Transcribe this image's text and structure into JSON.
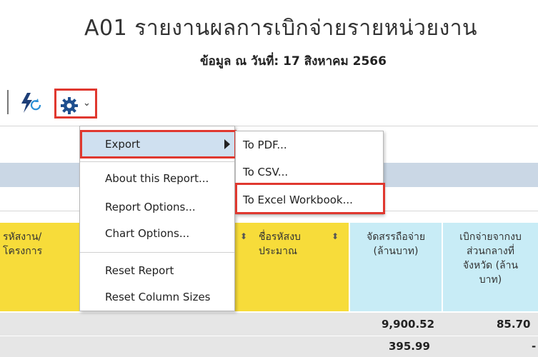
{
  "report": {
    "title": "A01 รายงานผลการเบิกจ่ายรายหน่วยงาน",
    "subtitle": "ข้อมูล ณ วันที่: 17 สิงหาคม 2566"
  },
  "colors": {
    "highlight": "#e0382f",
    "yellow_header": "#f7dc3a",
    "blue_header": "#c8ecf6",
    "menu_selected": "#cfe0f0"
  },
  "toolbar": {
    "refresh_icon": "lightning-refresh-icon",
    "settings_icon": "gear-icon",
    "chevron": "⌄"
  },
  "menu": {
    "export": "Export",
    "about": "About this Report...",
    "options": "Report Options...",
    "chart": "Chart Options...",
    "reset": "Reset Report",
    "reset_cols": "Reset Column Sizes"
  },
  "submenu": {
    "pdf": "To PDF...",
    "csv": "To CSV...",
    "excel": "To Excel Workbook..."
  },
  "columns": {
    "c1_line1": "รหัสงาน/",
    "c1_line2": "โครงการ",
    "c2_line1": "ชื่อรหัสงบ",
    "c2_line2": "ประมาณ",
    "c3_line1": "จัดสรรถือจ่าย",
    "c3_line2": "(ล้านบาท)",
    "c4_line1": "เบิกจ่ายจากงบ",
    "c4_line2": "ส่วนกลางที่",
    "c4_line3": "จังหวัด (ล้าน",
    "c4_line4": "บาท)",
    "sort_glyph": "⬍"
  },
  "rows": [
    {
      "allocated": "9,900.52",
      "disbursed": "85.70"
    },
    {
      "allocated": "395.99",
      "disbursed": "-"
    }
  ]
}
